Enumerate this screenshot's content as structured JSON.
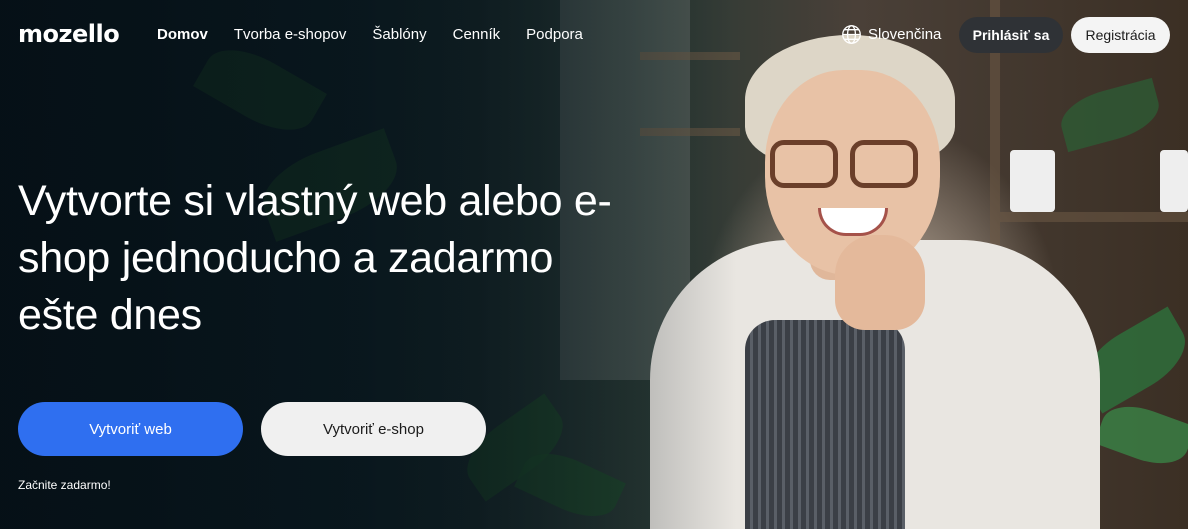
{
  "brand": {
    "logo_text": "mozello"
  },
  "nav": {
    "items": [
      {
        "label": "Domov",
        "active": true
      },
      {
        "label": "Tvorba e-shopov",
        "active": false
      },
      {
        "label": "Šablóny",
        "active": false
      },
      {
        "label": "Cenník",
        "active": false
      },
      {
        "label": "Podpora",
        "active": false
      }
    ],
    "language_label": "Slovenčina",
    "language_icon": "globe-icon",
    "login_label": "Prihlásiť sa",
    "register_label": "Registrácia"
  },
  "hero": {
    "headline": "Vytvorte si vlastný web alebo e-shop jednoducho a zadarmo ešte dnes",
    "primary_cta": "Vytvoriť web",
    "secondary_cta": "Vytvoriť e-shop",
    "note": "Začnite zadarmo!"
  },
  "colors": {
    "primary": "#2f6ff0",
    "login_bg": "#2f3236",
    "light_button_bg": "#f0f0f0"
  }
}
